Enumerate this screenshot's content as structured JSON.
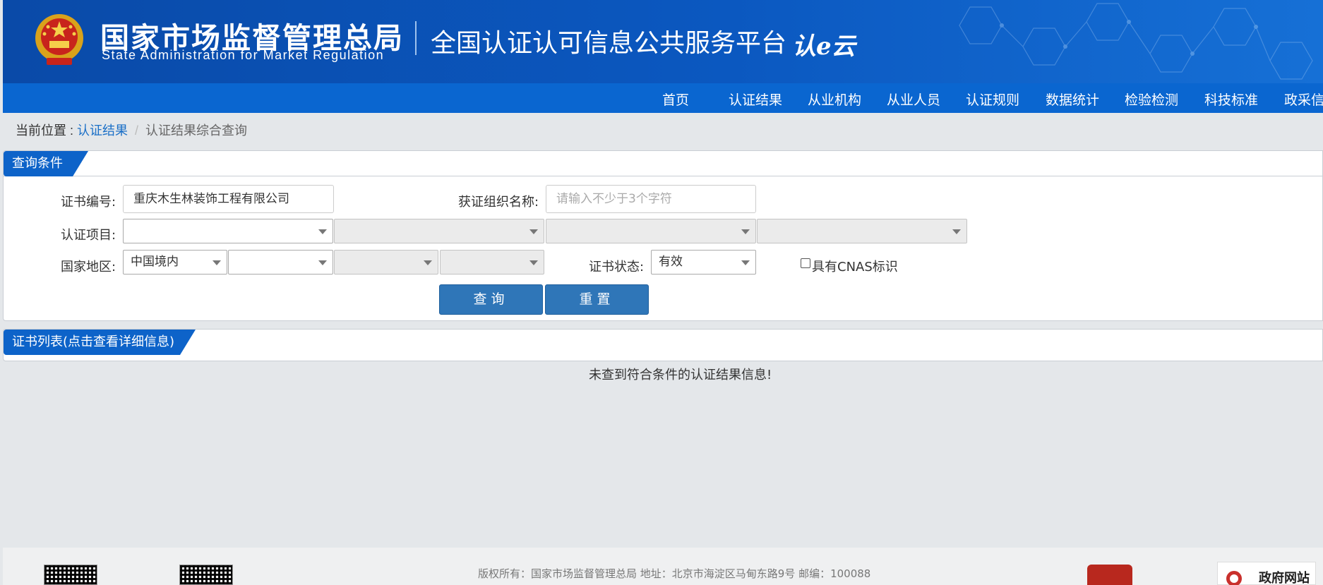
{
  "header": {
    "org_name_cn": "国家市场监督管理总局",
    "org_name_en": "State Administration  for  Market Regulation",
    "platform_title": "全国认证认可信息公共服务平台",
    "logo_text": "认e云"
  },
  "nav": {
    "items": [
      "首页",
      "认证结果",
      "从业机构",
      "从业人员",
      "认证规则",
      "数据统计",
      "检验检测",
      "科技标准",
      "政采信"
    ]
  },
  "breadcrumb": {
    "prefix": "当前位置 : ",
    "link": "认证结果",
    "separator": "/",
    "current": "认证结果综合查询"
  },
  "query_panel": {
    "title": "查询条件",
    "cert_no_label": "证书编号:",
    "cert_no_value": "重庆木生林装饰工程有限公司",
    "org_name_label": "获证组织名称:",
    "org_name_placeholder": "请输入不少于3个字符",
    "project_label": "认证项目:",
    "region_label": "国家地区:",
    "region_value": "中国境内",
    "status_label": "证书状态:",
    "status_value": "有效",
    "cnas_label": "具有CNAS标识",
    "search_button": "查询",
    "reset_button": "重置"
  },
  "list_panel": {
    "title": "证书列表(点击查看详细信息)",
    "empty_message": "未查到符合条件的认证结果信息!"
  },
  "footer": {
    "copyright": "版权所有：国家市场监督管理总局     地址：北京市海淀区马甸东路9号     邮编：100088",
    "gov_site_label": "政府网站"
  },
  "colors": {
    "header_blue": "#0b58c0",
    "nav_blue": "#0a66d0",
    "button_blue": "#2f76b8",
    "link_blue": "#1a6fc7"
  }
}
